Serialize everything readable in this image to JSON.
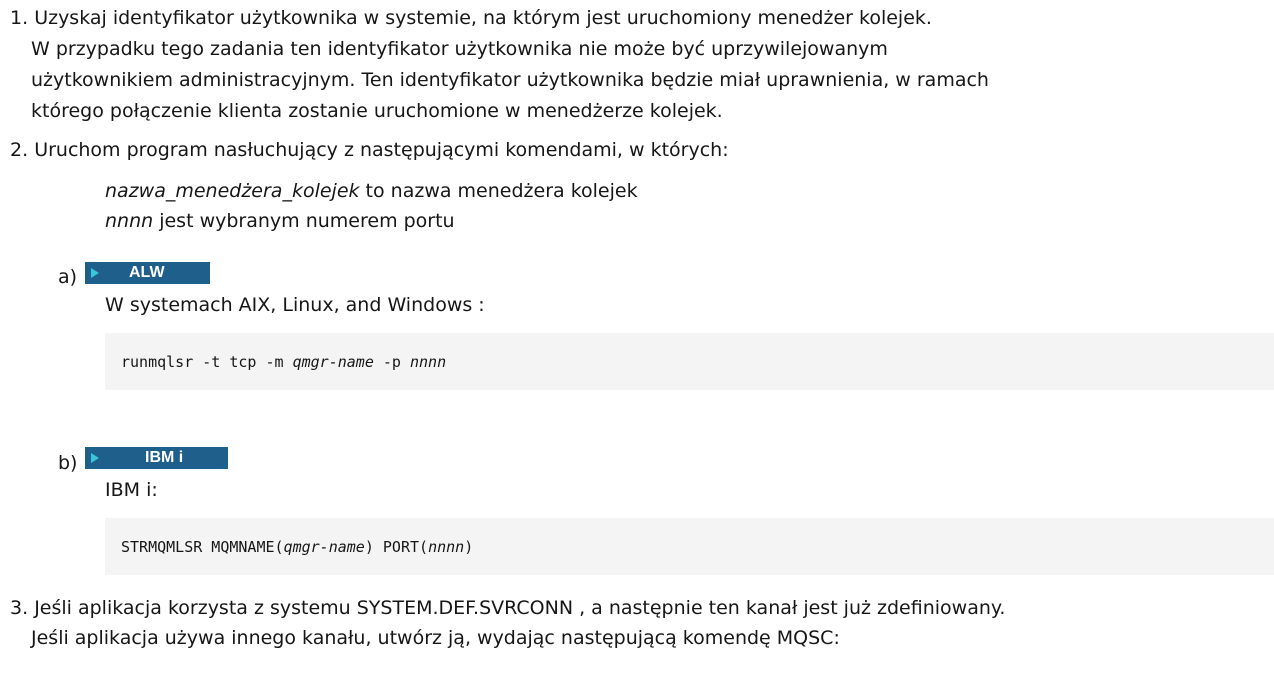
{
  "steps": [
    {
      "marker": "1.",
      "lines": [
        "Uzyskaj identyfikator użytkownika w systemie, na którym jest uruchomiony menedżer kolejek.",
        "W przypadku tego zadania ten identyfikator użytkownika nie może być uprzywilejowanym",
        "użytkownikiem administracyjnym. Ten identyfikator użytkownika będzie miał uprawnienia, w ramach",
        "którego połączenie klienta zostanie uruchomione w menedżerze kolejek."
      ]
    },
    {
      "marker": "2.",
      "lines": [
        "Uruchom program nasłuchujący z następującymi komendami, w których:"
      ],
      "definitions": [
        {
          "term": "nazwa_menedżera_kolejek",
          "desc": " to nazwa menedżera kolejek"
        },
        {
          "term": "nnnn",
          "desc": " jest wybranym numerem portu"
        }
      ],
      "substeps": [
        {
          "marker": "a)",
          "badge": "ALW",
          "text": "W systemach AIX, Linux, and Windows :",
          "code": {
            "cmd": "runmqlsr -t tcp -m ",
            "arg1": "qmgr-name",
            "mid": " -p ",
            "arg2": "nnnn",
            "end": ""
          }
        },
        {
          "marker": "b)",
          "badge": "IBM i",
          "text": "IBM i:",
          "code": {
            "cmd": "STRMQMLSR MQMNAME(",
            "arg1": "qmgr-name",
            "mid": ") PORT(",
            "arg2": "nnnn",
            "end": ")"
          }
        }
      ]
    },
    {
      "marker": "3.",
      "lines": [
        "Jeśli aplikacja korzysta z systemu SYSTEM.DEF.SVRCONN , a następnie ten kanał jest już zdefiniowany.",
        "Jeśli aplikacja używa innego kanału, utwórz ją, wydając następującą komendę MQSC:"
      ]
    }
  ],
  "colors": {
    "badge_bg": "#1f5f8b",
    "badge_arrow": "#39c6d6",
    "code_bg": "#f4f4f4",
    "text": "#161616"
  }
}
